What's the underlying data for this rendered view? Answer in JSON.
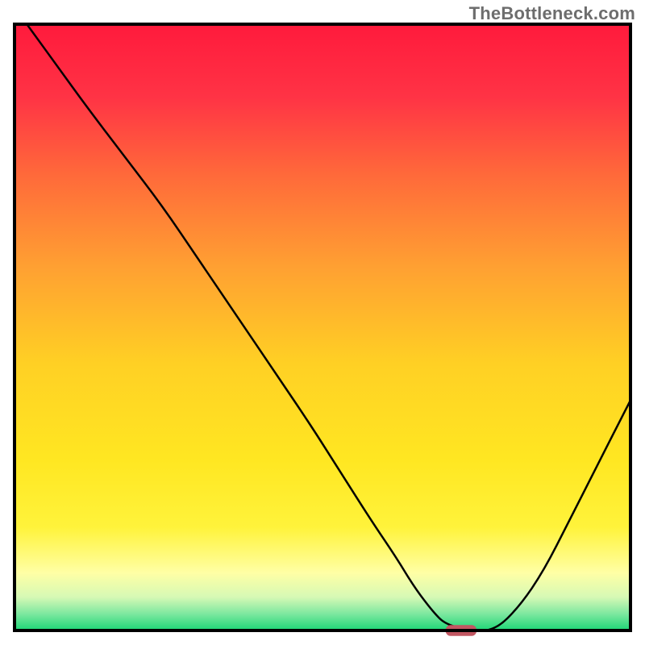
{
  "watermark": "TheBottleneck.com",
  "colors": {
    "border": "#000000",
    "curve": "#000000",
    "marker_fill": "#c25762",
    "gradient_stops": [
      {
        "offset": 0.0,
        "color": "#ff1a3c"
      },
      {
        "offset": 0.12,
        "color": "#ff3345"
      },
      {
        "offset": 0.25,
        "color": "#ff6a3a"
      },
      {
        "offset": 0.4,
        "color": "#ffa032"
      },
      {
        "offset": 0.56,
        "color": "#ffd024"
      },
      {
        "offset": 0.72,
        "color": "#ffe722"
      },
      {
        "offset": 0.83,
        "color": "#fff33b"
      },
      {
        "offset": 0.905,
        "color": "#ffffa5"
      },
      {
        "offset": 0.945,
        "color": "#d6f9b5"
      },
      {
        "offset": 0.972,
        "color": "#7fe8a0"
      },
      {
        "offset": 1.0,
        "color": "#1cd676"
      }
    ]
  },
  "chart_data": {
    "type": "line",
    "title": "",
    "xlabel": "",
    "ylabel": "",
    "xlim": [
      0,
      100
    ],
    "ylim": [
      0,
      100
    ],
    "x": [
      2,
      7,
      12,
      18,
      24,
      30,
      36,
      42,
      48,
      53,
      58,
      62,
      65,
      68,
      70,
      74,
      78,
      82,
      86,
      90,
      94,
      98,
      100
    ],
    "values": [
      100,
      93,
      86,
      78,
      70,
      61,
      52,
      43,
      34,
      26,
      18,
      12,
      7,
      3,
      1,
      0,
      0,
      4,
      10,
      18,
      26,
      34,
      38
    ],
    "marker": {
      "x": 72.5,
      "y": 0,
      "w": 5,
      "h": 1.8
    },
    "legend": null,
    "grid": false,
    "annotations": []
  }
}
